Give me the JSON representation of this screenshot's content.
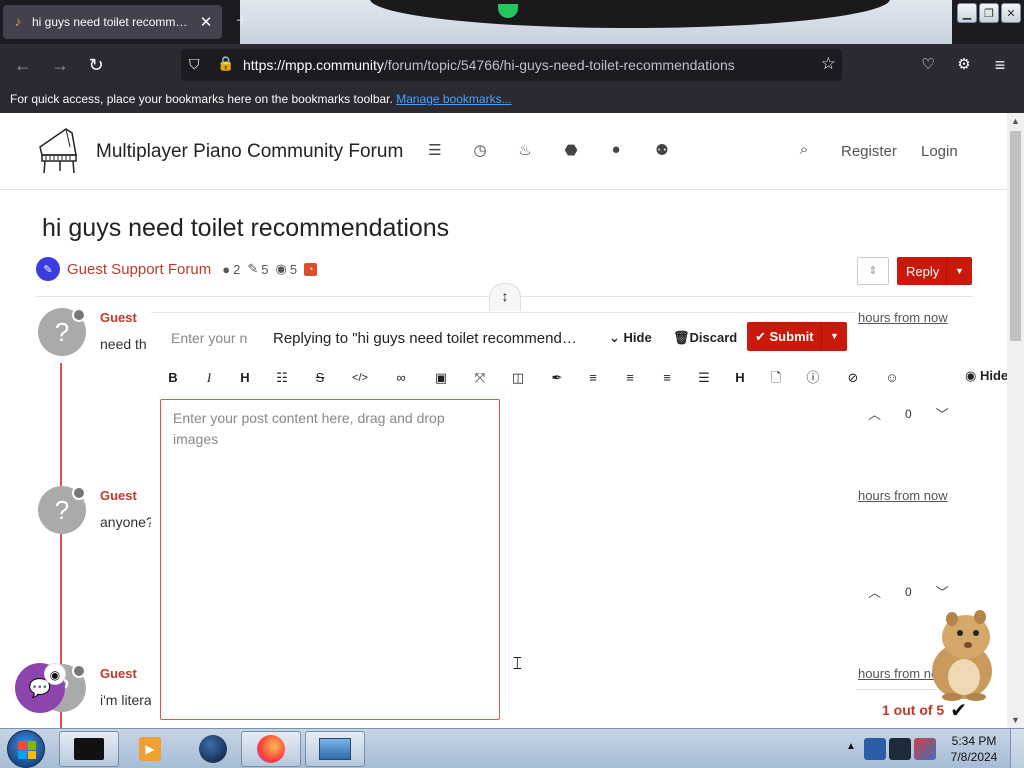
{
  "browser": {
    "tab_title": "hi guys need toilet recommend",
    "tab_icon": "music-note-icon",
    "url_host": "https://mpp.community",
    "url_path": "/forum/topic/54766/hi-guys-need-toilet-recommendations",
    "bookmarks_prompt": "For quick access, place your bookmarks here on the bookmarks toolbar.",
    "bookmarks_link": "Manage bookmarks..."
  },
  "site": {
    "title": "Multiplayer Piano Community Forum",
    "nav_icons": [
      "list-icon",
      "clock-icon",
      "fire-icon",
      "tags-icon",
      "user-icon",
      "users-icon"
    ],
    "register": "Register",
    "login": "Login"
  },
  "topic": {
    "title": "hi guys need toilet recommendations",
    "category": "Guest Support Forum",
    "posters": "2",
    "posts": "5",
    "views": "5",
    "reply_label": "Reply"
  },
  "posts": [
    {
      "author": "Guest",
      "body": "need th",
      "time": "hours from now",
      "votes": "0"
    },
    {
      "author": "Guest",
      "body": "anyone?",
      "time": "hours from now",
      "votes": "0"
    },
    {
      "author": "Guest",
      "body": "i'm litera",
      "time": "hours from now"
    }
  ],
  "progress": "1 out of 5",
  "composer": {
    "title_placeholder": "Enter your n",
    "replying_to": "Replying to \"hi guys need toilet recommendati...",
    "hide_label": "Hide",
    "discard_label": "Discard",
    "submit_label": "Submit",
    "toolbar_hide_label": "Hide",
    "editor_placeholder": "Enter your post content here, drag and drop images"
  },
  "taskbar": {
    "time": "5:34 PM",
    "date": "7/8/2024"
  },
  "colors": {
    "accent": "#c9190b",
    "link": "#c0392b",
    "chrome_bg": "#2b2a33",
    "chat_fab": "#8e44ad"
  }
}
